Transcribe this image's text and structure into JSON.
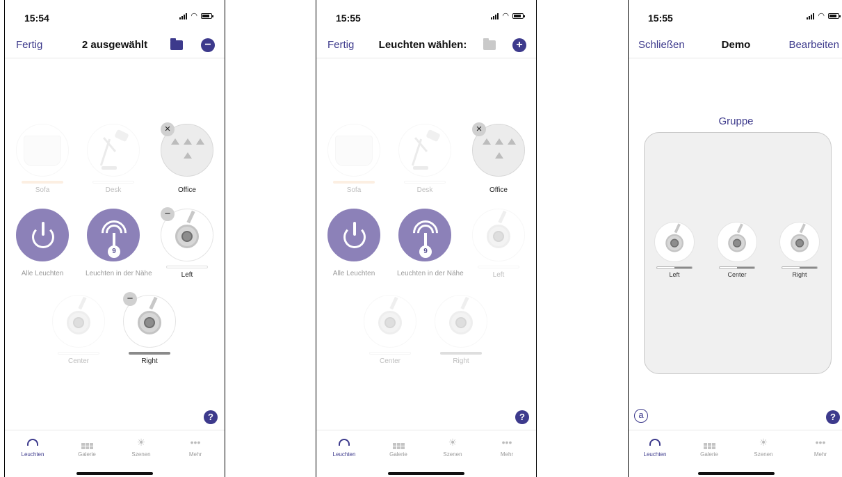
{
  "screens": [
    {
      "status": {
        "time": "15:54"
      },
      "nav": {
        "left": "Fertig",
        "title": "2 ausgewählt",
        "right_symbol": "−"
      },
      "tiles": [
        {
          "label": "Sofa"
        },
        {
          "label": "Desk"
        },
        {
          "label": "Office",
          "badge": "×"
        },
        {
          "label": "Alle Leuchten"
        },
        {
          "label": "Leuchten in der Nähe",
          "count": "9"
        },
        {
          "label": "Left",
          "badge": "−"
        },
        {
          "label": "Center"
        },
        {
          "label": "Right",
          "badge": "−"
        }
      ],
      "help": "?"
    },
    {
      "status": {
        "time": "15:55"
      },
      "nav": {
        "left": "Fertig",
        "title": "Leuchten wählen:",
        "right_symbol": "+"
      },
      "tiles": [
        {
          "label": "Sofa"
        },
        {
          "label": "Desk"
        },
        {
          "label": "Office",
          "badge": "×"
        },
        {
          "label": "Alle Leuchten"
        },
        {
          "label": "Leuchten in der Nähe",
          "count": "9"
        },
        {
          "label": "Left"
        },
        {
          "label": "Center"
        },
        {
          "label": "Right"
        }
      ],
      "help": "?"
    },
    {
      "status": {
        "time": "15:55"
      },
      "nav": {
        "left": "Schließen",
        "title": "Demo",
        "right": "Bearbeiten"
      },
      "group": {
        "title": "Gruppe",
        "lights": [
          {
            "label": "Left",
            "level": 0.5
          },
          {
            "label": "Center",
            "level": 0.5
          },
          {
            "label": "Right",
            "level": 0.5
          }
        ]
      },
      "a_symbol": "a",
      "help": "?"
    }
  ],
  "tabbar": {
    "items": [
      {
        "label": "Leuchten",
        "icon": "ceiling-lamp-icon",
        "active": true
      },
      {
        "label": "Galerie",
        "icon": "grid-icon"
      },
      {
        "label": "Szenen",
        "icon": "sun-icon"
      },
      {
        "label": "Mehr",
        "icon": "more-dots-icon"
      }
    ]
  },
  "colors": {
    "accent": "#3d3a8c",
    "tile_purple": "#8c81b8",
    "sofa_bar": "#f6c89a"
  }
}
